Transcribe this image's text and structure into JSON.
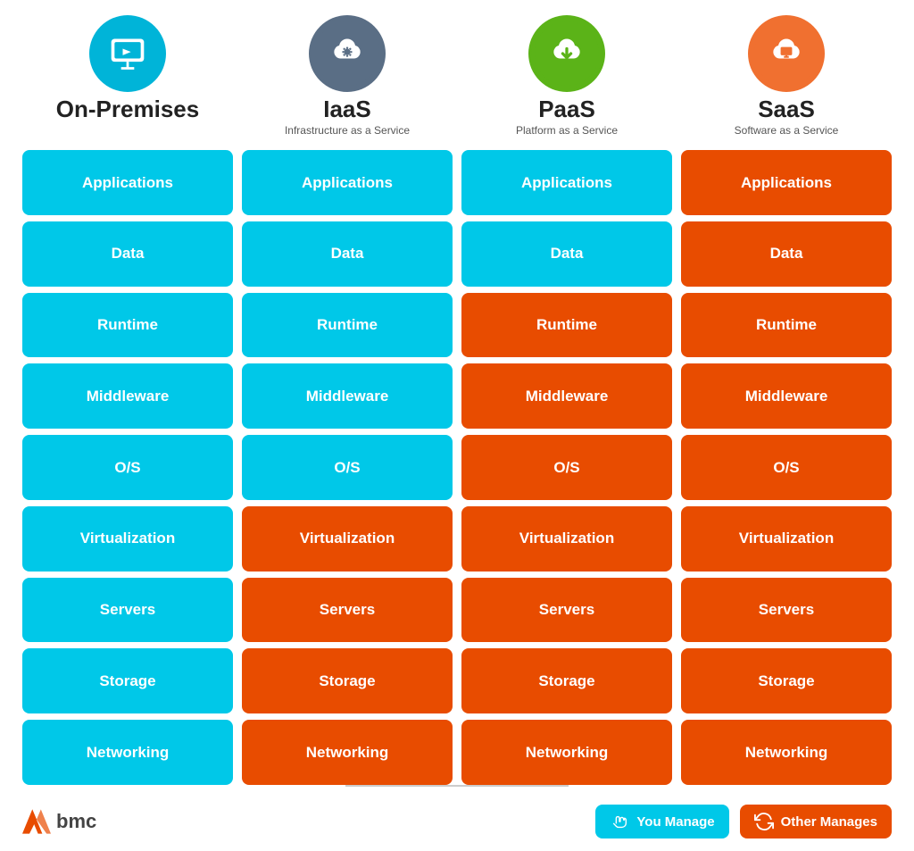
{
  "columns": [
    {
      "id": "on-premises",
      "icon": "monitor",
      "icon_color": "blue",
      "title": "On-Premises",
      "subtitle": ""
    },
    {
      "id": "iaas",
      "icon": "gear-cloud",
      "icon_color": "gray",
      "title": "IaaS",
      "subtitle": "Infrastructure as a Service"
    },
    {
      "id": "paas",
      "icon": "cloud-download",
      "icon_color": "green",
      "title": "PaaS",
      "subtitle": "Platform as a Service"
    },
    {
      "id": "saas",
      "icon": "cloud-screen",
      "icon_color": "orange",
      "title": "SaaS",
      "subtitle": "Software as a Service"
    }
  ],
  "rows": [
    {
      "label": "Applications",
      "colors": [
        "cyan",
        "cyan",
        "cyan",
        "orange"
      ]
    },
    {
      "label": "Data",
      "colors": [
        "cyan",
        "cyan",
        "cyan",
        "orange"
      ]
    },
    {
      "label": "Runtime",
      "colors": [
        "cyan",
        "cyan",
        "orange",
        "orange"
      ]
    },
    {
      "label": "Middleware",
      "colors": [
        "cyan",
        "cyan",
        "orange",
        "orange"
      ]
    },
    {
      "label": "O/S",
      "colors": [
        "cyan",
        "cyan",
        "orange",
        "orange"
      ]
    },
    {
      "label": "Virtualization",
      "colors": [
        "cyan",
        "orange",
        "orange",
        "orange"
      ]
    },
    {
      "label": "Servers",
      "colors": [
        "cyan",
        "orange",
        "orange",
        "orange"
      ]
    },
    {
      "label": "Storage",
      "colors": [
        "cyan",
        "orange",
        "orange",
        "orange"
      ]
    },
    {
      "label": "Networking",
      "colors": [
        "cyan",
        "orange",
        "orange",
        "orange"
      ]
    }
  ],
  "legend": {
    "you_manage": "You Manage",
    "other_manages": "Other Manages"
  },
  "brand": "bmc"
}
